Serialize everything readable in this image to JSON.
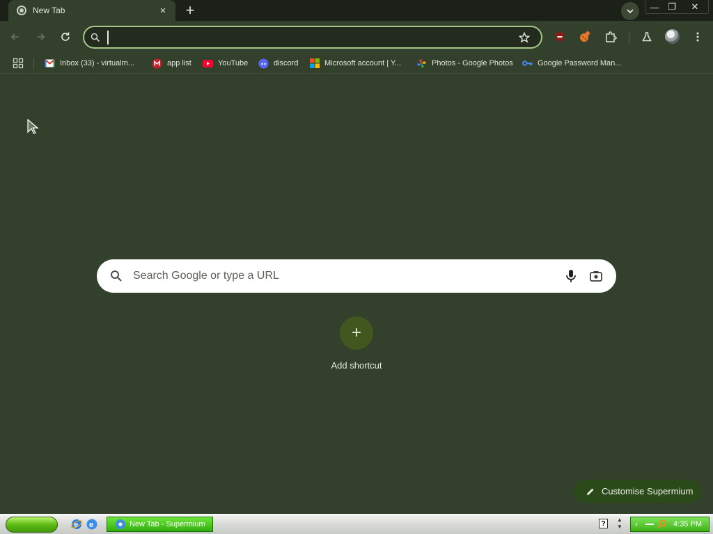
{
  "tab": {
    "title": "New Tab",
    "close": "×"
  },
  "tabstrip": {
    "new_tab": "+"
  },
  "window": {
    "minimize": "—",
    "maximize": "❐",
    "close": "✕"
  },
  "omnibox": {
    "value": ""
  },
  "bookmarks": [
    {
      "label": "Inbox (33) - virtualm...",
      "icon": "gmail-icon"
    },
    {
      "label": "app list",
      "icon": "m-icon"
    },
    {
      "label": "YouTube",
      "icon": "youtube-icon"
    },
    {
      "label": "discord",
      "icon": "discord-icon"
    },
    {
      "label": "Microsoft account | Y...",
      "icon": "microsoft-icon"
    },
    {
      "label": "Photos - Google Photos",
      "icon": "photos-icon"
    },
    {
      "label": "Google Password Man...",
      "icon": "key-icon"
    }
  ],
  "search": {
    "placeholder": "Search Google or type a URL"
  },
  "shortcut": {
    "add_symbol": "+",
    "add_label": "Add shortcut"
  },
  "customise": {
    "label": "Customise Supermium"
  },
  "taskbar": {
    "task_label": "New Tab - Supermium",
    "help": "?",
    "clock": "4:35 PM"
  },
  "colors": {
    "background": "#33402b",
    "tabstrip": "#1b2018",
    "omnibox_border": "#a6c98a",
    "customise_bg": "#2a4a1a",
    "add_circle": "#41571f"
  }
}
